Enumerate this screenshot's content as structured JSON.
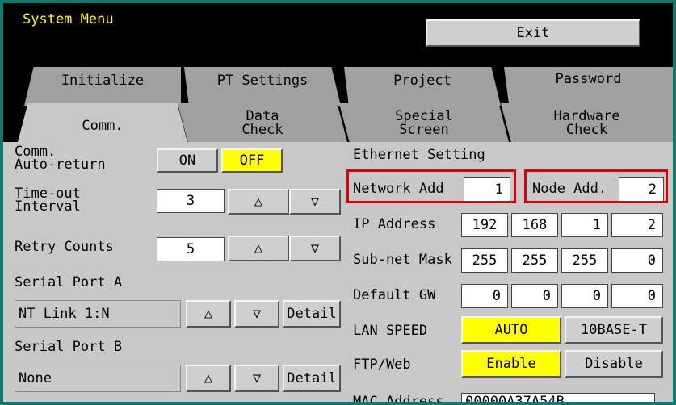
{
  "window": {
    "title": "System Menu",
    "exit_label": "Exit"
  },
  "tabs": {
    "top": [
      "Initialize",
      "PT Settings",
      "Project",
      "Password"
    ],
    "bottom": [
      {
        "line1": "Comm.",
        "line2": ""
      },
      {
        "line1": "Data",
        "line2": "Check"
      },
      {
        "line1": "Special",
        "line2": "Screen"
      },
      {
        "line1": "Hardware",
        "line2": "Check"
      }
    ]
  },
  "left": {
    "comm_label_1": "Comm.",
    "comm_label_2": "Auto-return",
    "on_label": "ON",
    "off_label": "OFF",
    "timeout_label_1": "Time-out",
    "timeout_label_2": "Interval",
    "timeout_value": "3",
    "retry_label": "Retry Counts",
    "retry_value": "5",
    "up_symbol": "△",
    "down_symbol": "▽",
    "serial_a_label": "Serial Port A",
    "serial_a_value": "NT Link 1:N",
    "serial_b_label": "Serial Port B",
    "serial_b_value": "None",
    "detail_label": "Detail"
  },
  "ethernet": {
    "heading": "Ethernet Setting",
    "network_label": "Network Add",
    "network_value": "1",
    "node_label": "Node Add.",
    "node_value": "2",
    "ip_label": "IP Address",
    "ip": [
      "192",
      "168",
      "1",
      "2"
    ],
    "subnet_label": "Sub-net Mask",
    "subnet": [
      "255",
      "255",
      "255",
      "0"
    ],
    "gateway_label": "Default GW",
    "gateway": [
      "0",
      "0",
      "0",
      "0"
    ],
    "lan_label": "LAN SPEED",
    "lan_auto": "AUTO",
    "lan_10": "10BASE-T",
    "ftp_label": "FTP/Web",
    "ftp_enable": "Enable",
    "ftp_disable": "Disable",
    "mac_label": "MAC Address",
    "mac_value": "00000A37A54B"
  },
  "colors": {
    "accent": "#ffff00",
    "highlight": "#e00000",
    "title_text": "#ffff00"
  }
}
